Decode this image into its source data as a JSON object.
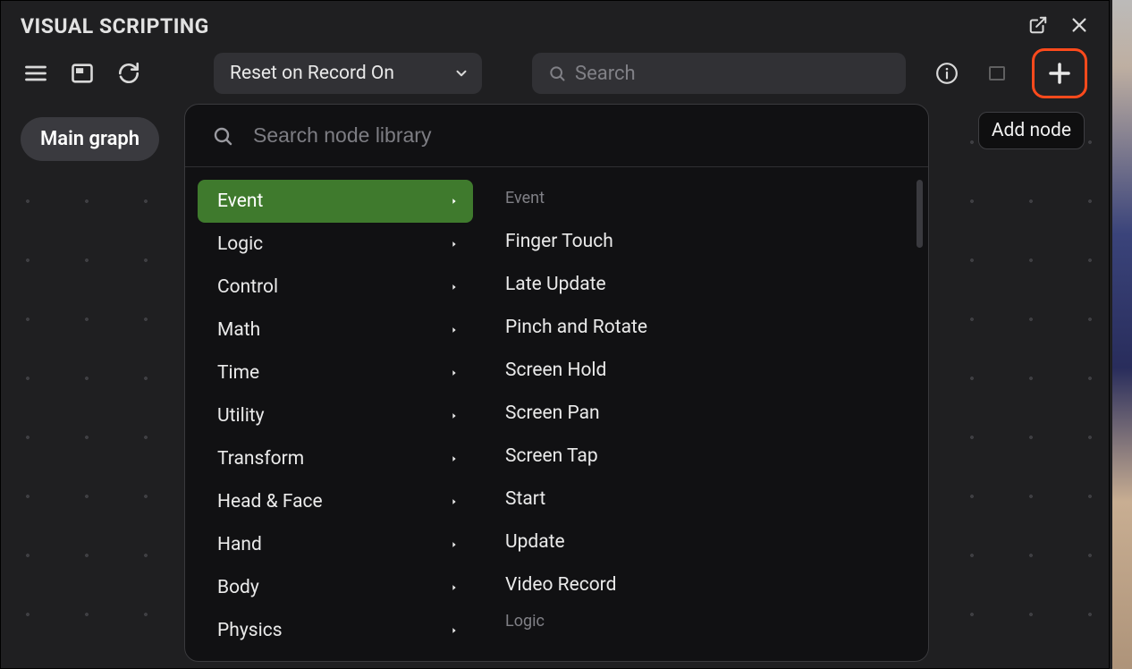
{
  "window": {
    "title": "VISUAL SCRIPTING"
  },
  "toolbar": {
    "dropdown_label": "Reset on Record On",
    "search_placeholder": "Search",
    "add_tooltip": "Add node"
  },
  "graph": {
    "chip_label": "Main graph"
  },
  "library": {
    "search_placeholder": "Search node library",
    "categories": [
      {
        "label": "Event",
        "selected": true
      },
      {
        "label": "Logic",
        "selected": false
      },
      {
        "label": "Control",
        "selected": false
      },
      {
        "label": "Math",
        "selected": false
      },
      {
        "label": "Time",
        "selected": false
      },
      {
        "label": "Utility",
        "selected": false
      },
      {
        "label": "Transform",
        "selected": false
      },
      {
        "label": "Head & Face",
        "selected": false
      },
      {
        "label": "Hand",
        "selected": false
      },
      {
        "label": "Body",
        "selected": false
      },
      {
        "label": "Physics",
        "selected": false
      }
    ],
    "sections": [
      {
        "label": "Event",
        "items": [
          "Finger Touch",
          "Late Update",
          "Pinch and Rotate",
          "Screen Hold",
          "Screen Pan",
          "Screen Tap",
          "Start",
          "Update",
          "Video Record"
        ]
      },
      {
        "label": "Logic",
        "items": []
      }
    ]
  }
}
